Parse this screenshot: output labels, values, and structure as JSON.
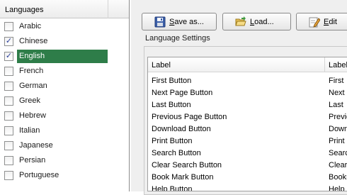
{
  "languages": {
    "header": "Languages",
    "items": [
      {
        "label": "Arabic",
        "checked": false,
        "selected": false
      },
      {
        "label": "Chinese",
        "checked": true,
        "selected": false
      },
      {
        "label": "English",
        "checked": true,
        "selected": true
      },
      {
        "label": "French",
        "checked": false,
        "selected": false
      },
      {
        "label": "German",
        "checked": false,
        "selected": false
      },
      {
        "label": "Greek",
        "checked": false,
        "selected": false
      },
      {
        "label": "Hebrew",
        "checked": false,
        "selected": false
      },
      {
        "label": "Italian",
        "checked": false,
        "selected": false
      },
      {
        "label": "Japanese",
        "checked": false,
        "selected": false
      },
      {
        "label": "Persian",
        "checked": false,
        "selected": false
      },
      {
        "label": "Portuguese",
        "checked": false,
        "selected": false
      }
    ]
  },
  "toolbar": {
    "save_mnemonic": "S",
    "save_rest": "ave as...",
    "load_mnemonic": "L",
    "load_rest": "oad...",
    "edit_mnemonic": "E",
    "edit_rest": "dit"
  },
  "settings": {
    "group_title": "Language Settings",
    "columns": [
      "Label",
      "Labels"
    ],
    "rows": [
      [
        "First Button",
        "First"
      ],
      [
        "Next Page Button",
        "Next"
      ],
      [
        "Last Button",
        "Last"
      ],
      [
        "Previous Page Button",
        "Previous"
      ],
      [
        "Download Button",
        "Download"
      ],
      [
        "Print Button",
        "Print"
      ],
      [
        "Search Button",
        "Search"
      ],
      [
        "Clear Search Button",
        "Clear"
      ],
      [
        "Book Mark Button",
        "Bookmark"
      ],
      [
        "Help Button",
        "Help"
      ]
    ]
  },
  "colors": {
    "selection": "#2e7d49",
    "checkmark": "#2b3f9a"
  }
}
